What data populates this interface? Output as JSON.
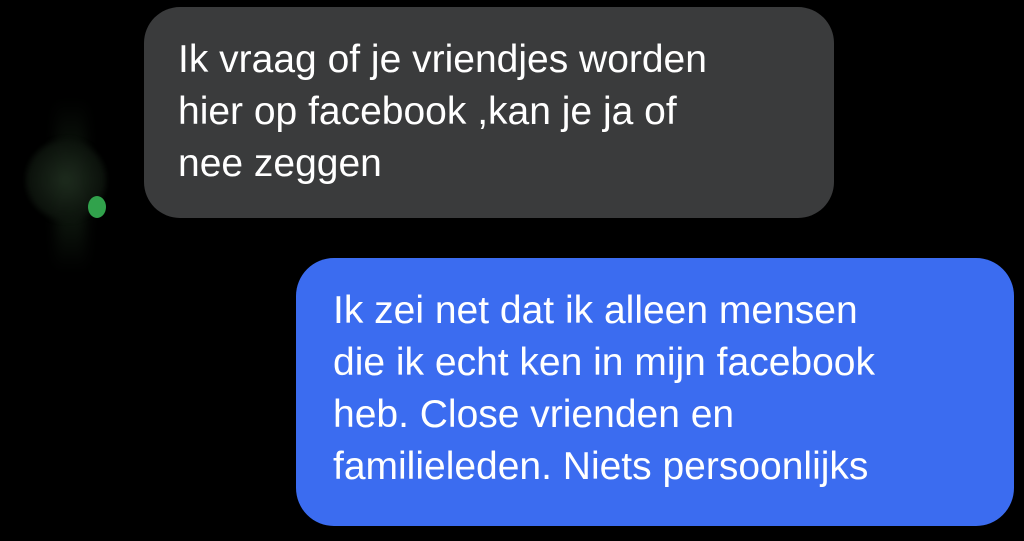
{
  "conversation": {
    "incoming_message": "Ik vraag of je vriendjes worden\nhier op facebook  ,kan je ja of\nnee zeggen",
    "outgoing_message": "Ik zei net dat ik alleen mensen\ndie ik echt ken in mijn facebook\nheb. Close vrienden en\nfamilieleden. Niets persoonlijks"
  },
  "colors": {
    "background": "#000000",
    "incoming_bubble": "#3a3b3c",
    "outgoing_bubble": "#3b6cf0",
    "online_indicator": "#31a24c",
    "text": "#ffffff"
  },
  "icons": {
    "contact_avatar": "avatar-blurred",
    "presence": "online-dot-icon"
  }
}
